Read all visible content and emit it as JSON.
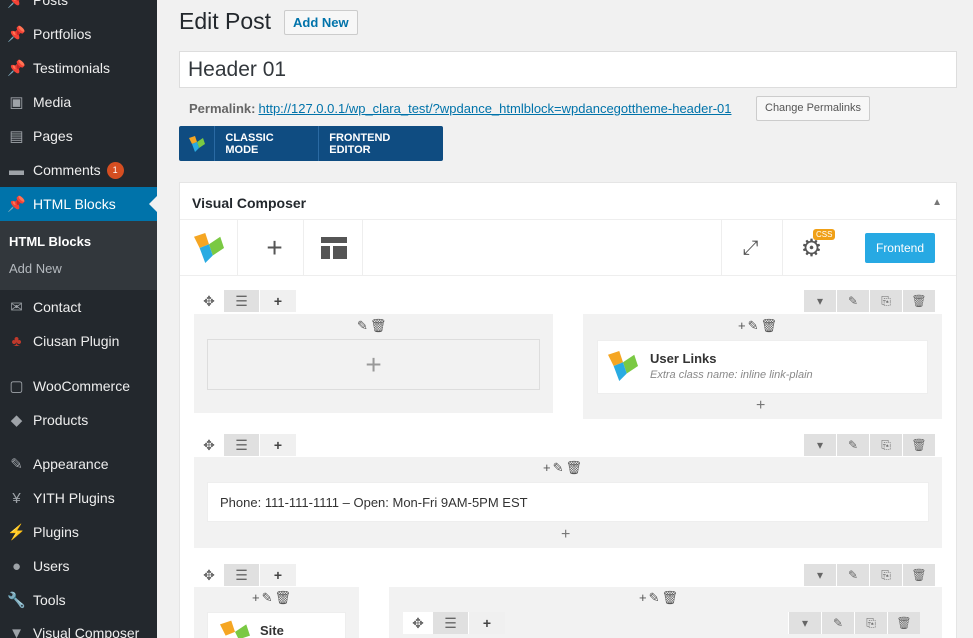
{
  "sidebar": {
    "items": [
      {
        "label": "Posts",
        "icon": "pin-icon"
      },
      {
        "label": "Portfolios",
        "icon": "pin-icon"
      },
      {
        "label": "Testimonials",
        "icon": "pin-icon"
      },
      {
        "label": "Media",
        "icon": "media-icon"
      },
      {
        "label": "Pages",
        "icon": "pages-icon"
      },
      {
        "label": "Comments",
        "icon": "comment-icon",
        "badge": "1"
      },
      {
        "label": "HTML Blocks",
        "icon": "pin-icon",
        "active": true
      },
      {
        "label": "Contact",
        "icon": "mail-icon"
      },
      {
        "label": "Ciusan Plugin",
        "icon": "plugin-icon"
      },
      {
        "label": "WooCommerce",
        "icon": "woo-icon"
      },
      {
        "label": "Products",
        "icon": "products-icon"
      },
      {
        "label": "Appearance",
        "icon": "brush-icon"
      },
      {
        "label": "YITH Plugins",
        "icon": "yith-icon"
      },
      {
        "label": "Plugins",
        "icon": "plug-icon"
      },
      {
        "label": "Users",
        "icon": "user-icon"
      },
      {
        "label": "Tools",
        "icon": "wrench-icon"
      },
      {
        "label": "Visual Composer",
        "icon": "vc-icon"
      }
    ],
    "submenu": [
      {
        "label": "HTML Blocks",
        "current": true
      },
      {
        "label": "Add New"
      }
    ]
  },
  "page": {
    "title": "Edit Post",
    "add_new": "Add New",
    "post_title": "Header 01",
    "permalink_label": "Permalink:",
    "permalink_url": "http://127.0.0.1/wp_clara_test/?wpdance_htmlblock=wpdancegottheme-header-01",
    "change_permalinks": "Change Permalinks"
  },
  "vc_bar": {
    "classic_mode": "CLASSIC MODE",
    "frontend_editor": "FRONTEND EDITOR"
  },
  "composer": {
    "title": "Visual Composer",
    "frontend_btn": "Frontend",
    "css_badge": "CSS",
    "user_links_title": "User Links",
    "user_links_sub": "Extra class name: inline link-plain",
    "phone_text": "Phone: 111-111-1111 – Open: Mon-Fri 9AM-5PM EST",
    "site_title": "Site"
  },
  "colors": {
    "sidebar_bg": "#23282d",
    "active_bg": "#0073aa",
    "vc_bar_bg": "#0f4c81",
    "frontend_btn": "#27a9e3",
    "badge": "#d54e21"
  }
}
